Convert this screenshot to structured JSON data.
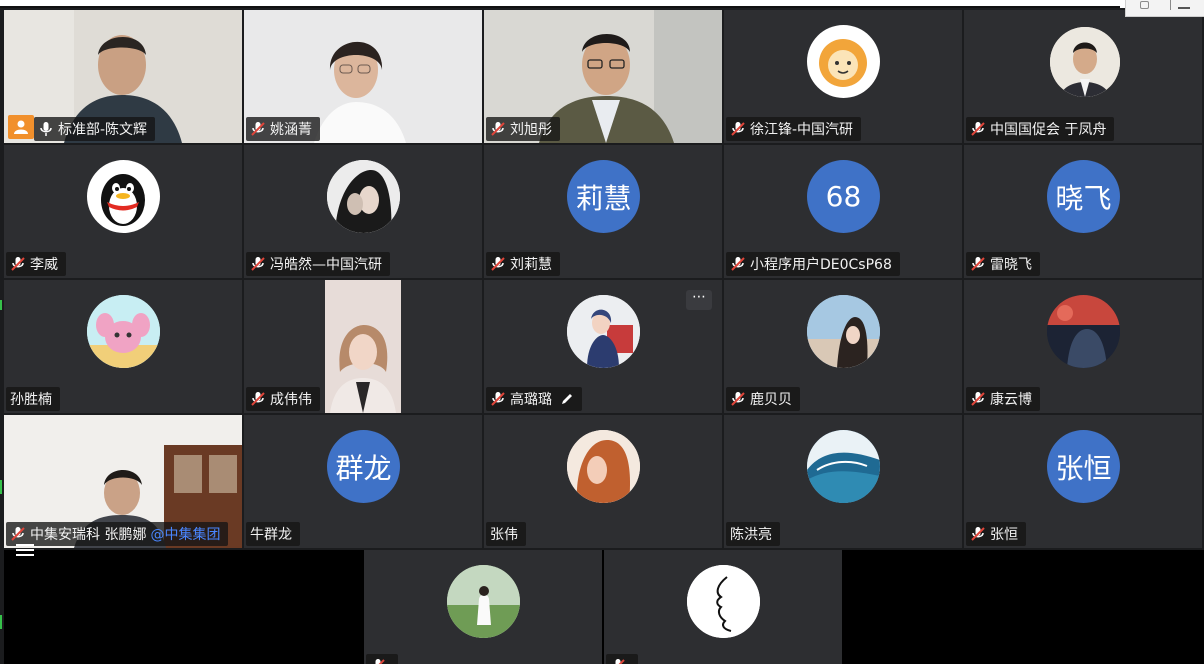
{
  "grid": {
    "rows": [
      [
        {
          "name": "标准部-陈文辉",
          "kind": "video",
          "mic": "on",
          "active": true
        },
        {
          "name": "姚涵菁",
          "kind": "video",
          "mic": "muted"
        },
        {
          "name": "刘旭彤",
          "kind": "video",
          "mic": "muted"
        },
        {
          "name": "徐江锋-中国汽研",
          "kind": "avatar",
          "avatar": "lion-cartoon",
          "mic": "muted"
        },
        {
          "name": "中国国促会 于凤舟",
          "kind": "avatar",
          "avatar": "man-photo",
          "mic": "muted"
        }
      ],
      [
        {
          "name": "李威",
          "kind": "avatar",
          "avatar": "penguin",
          "mic": "muted"
        },
        {
          "name": "冯皓然—中国汽研",
          "kind": "avatar",
          "avatar": "couple-photo",
          "mic": "muted"
        },
        {
          "name": "刘莉慧",
          "kind": "avatar",
          "avatar_text": "莉慧",
          "mic": "muted"
        },
        {
          "name": "小程序用户DE0CsP68",
          "kind": "avatar",
          "avatar_text": "68",
          "mic": "muted"
        },
        {
          "name": "雷晓飞",
          "kind": "avatar",
          "avatar_text": "晓飞",
          "mic": "muted"
        }
      ],
      [
        {
          "name": "孙胜楠",
          "kind": "avatar",
          "avatar": "pink-cartoon",
          "mic": "none"
        },
        {
          "name": "成伟伟",
          "kind": "video",
          "mic": "muted"
        },
        {
          "name": "高璐璐",
          "kind": "avatar",
          "avatar": "anime-girl",
          "mic": "muted",
          "editing": true,
          "more": "⋯"
        },
        {
          "name": "鹿贝贝",
          "kind": "avatar",
          "avatar": "girl-photo",
          "mic": "muted"
        },
        {
          "name": "康云博",
          "kind": "avatar",
          "avatar": "red-sky",
          "mic": "muted"
        }
      ],
      [
        {
          "name": "中集安瑞科 张鹏娜",
          "name_suffix": "@中集集团",
          "kind": "video",
          "mic": "muted"
        },
        {
          "name": "牛群龙",
          "kind": "avatar",
          "avatar_text": "群龙",
          "mic": "none"
        },
        {
          "name": "张伟",
          "kind": "avatar",
          "avatar": "woman-profile",
          "mic": "none"
        },
        {
          "name": "陈洪亮",
          "kind": "avatar",
          "avatar": "wave-photo",
          "mic": "none"
        },
        {
          "name": "张恒",
          "kind": "avatar",
          "avatar_text": "张恒",
          "mic": "muted"
        }
      ],
      [
        {
          "name": "",
          "kind": "avatar",
          "avatar": "field-girl",
          "mic": "muted"
        },
        {
          "name": "",
          "kind": "avatar",
          "avatar": "line-face",
          "mic": "muted"
        }
      ]
    ]
  },
  "colors": {
    "tile_bg": "#2d2e31",
    "active_border": "#2fd07a",
    "avatar_blue": "#3f72c7",
    "muted_red": "#e0453a",
    "badge_orange": "#f1902c"
  }
}
